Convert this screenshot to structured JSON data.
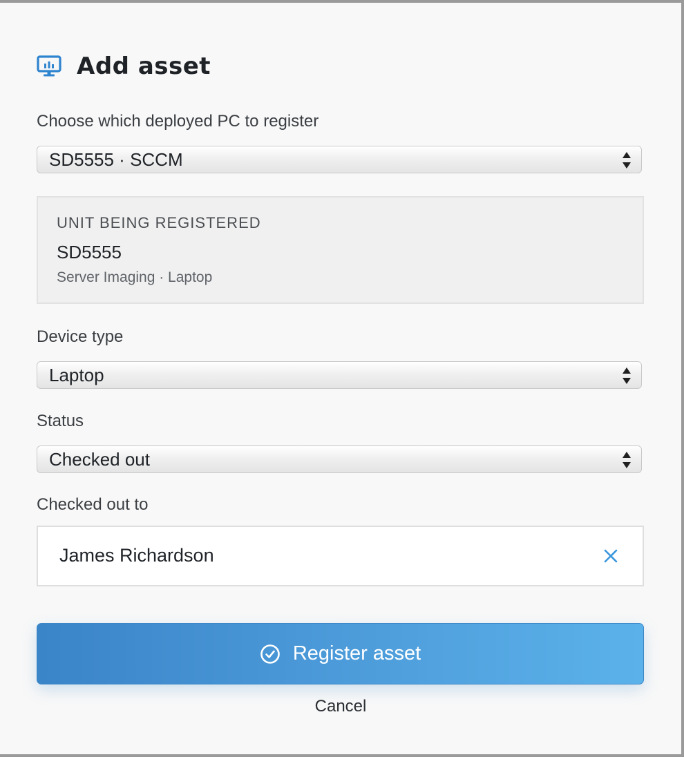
{
  "dialog": {
    "title": "Add asset",
    "title_icon": "monitor-chart-icon"
  },
  "deployed_pc": {
    "label": "Choose which deployed PC to register",
    "selected": "SD5555 · SCCM"
  },
  "unit_info": {
    "heading": "UNIT BEING REGISTERED",
    "id": "SD5555",
    "details": "Server Imaging · Laptop"
  },
  "device_type": {
    "label": "Device type",
    "selected": "Laptop"
  },
  "status": {
    "label": "Status",
    "selected": "Checked out"
  },
  "checked_out_to": {
    "label": "Checked out to",
    "value": "James Richardson",
    "clear_icon": "close-icon"
  },
  "actions": {
    "submit_label": "Register asset",
    "submit_icon": "check-circle-icon",
    "cancel_label": "Cancel"
  },
  "colors": {
    "accent": "#3a84c8",
    "accent_light": "#5bb2ea",
    "icon_blue": "#2f84cf"
  }
}
